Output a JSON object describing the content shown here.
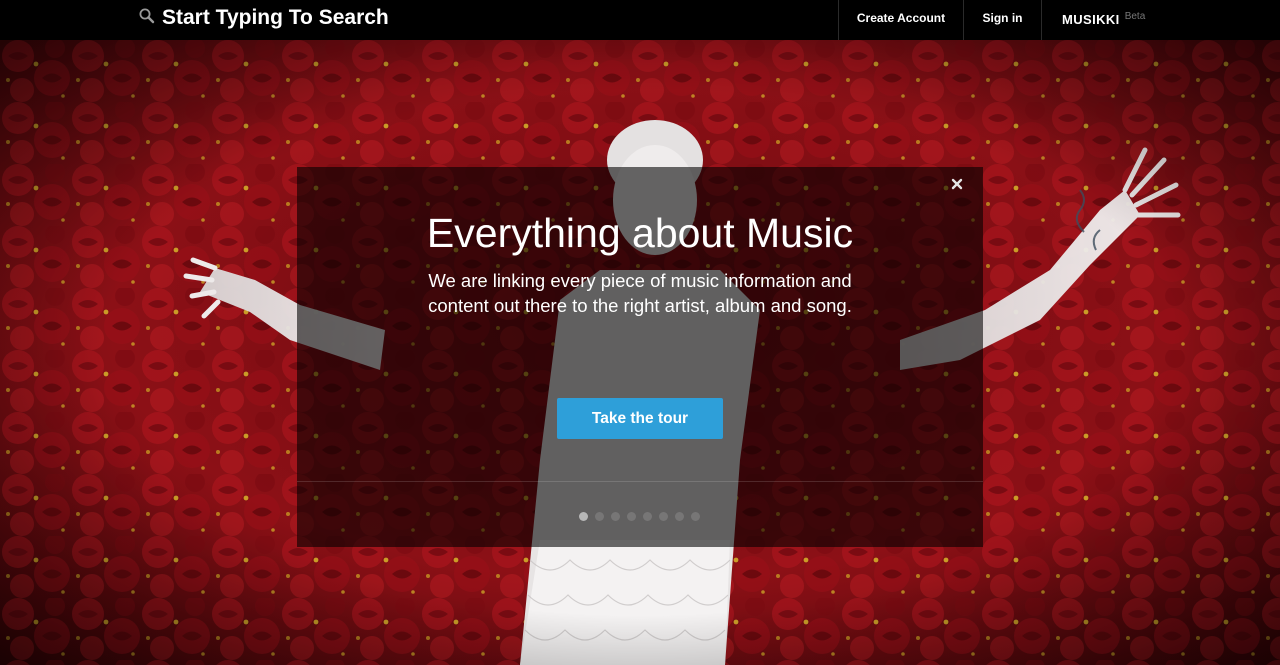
{
  "header": {
    "search_placeholder": "Start Typing To Search",
    "nav": {
      "create_account": "Create Account",
      "sign_in": "Sign in"
    },
    "brand": {
      "name": "MUSIKKI",
      "tag": "Beta"
    }
  },
  "modal": {
    "title": "Everything about Music",
    "text_line_1": "We are linking every piece of music information and",
    "text_line_2": "content out there to the right artist, album and song.",
    "button_label": "Take the tour",
    "close_icon": "close-icon",
    "pager": {
      "total": 8,
      "active": 1
    }
  },
  "colors": {
    "accent": "#2e9fd9",
    "background": "#000000",
    "hero_red": "#a0141a"
  }
}
